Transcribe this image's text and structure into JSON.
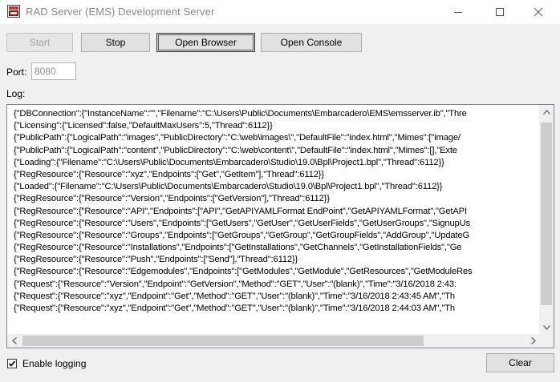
{
  "window": {
    "title": "RAD Server (EMS) Development Server",
    "minimize_glyph": "—",
    "maximize_glyph": "☐",
    "close_glyph": "✕"
  },
  "toolbar": {
    "start_label": "Start",
    "stop_label": "Stop",
    "open_browser_label": "Open Browser",
    "open_console_label": "Open Console"
  },
  "port": {
    "label": "Port:",
    "value": "8080"
  },
  "log": {
    "label": "Log:",
    "lines": [
      "{\"DBConnection\":{\"InstanceName\":\"\",\"Filename\":\"C:\\Users\\Public\\Documents\\Embarcadero\\EMS\\emsserver.ib\",\"Thre",
      "{\"Licensing\":{\"Licensed\":false,\"DefaultMaxUsers\":5,\"Thread\":6112}}",
      "{\"PublicPath\":{\"LogicalPath\":\"images\",\"PublicDirectory\":\"C:\\web\\images\\\",\"DefaultFile\":\"index.html\",\"Mimes\":[\"image/",
      "{\"PublicPath\":{\"LogicalPath\":\"content\",\"PublicDirectory\":\"C:\\web\\content\\\",\"DefaultFile\":\"index.html\",\"Mimes\":[],\"Exte",
      "{\"Loading\":{\"Filename\":\"C:\\Users\\Public\\Documents\\Embarcadero\\Studio\\19.0\\Bpl\\Project1.bpl\",\"Thread\":6112}}",
      "{\"RegResource\":{\"Resource\":\"xyz\",\"Endpoints\":[\"Get\",\"GetItem\"],\"Thread\":6112}}",
      "{\"Loaded\":{\"Filename\":\"C:\\Users\\Public\\Documents\\Embarcadero\\Studio\\19.0\\Bpl\\Project1.bpl\",\"Thread\":6112}}",
      "{\"RegResource\":{\"Resource\":\"Version\",\"Endpoints\":[\"GetVersion\"],\"Thread\":6112}}",
      "{\"RegResource\":{\"Resource\":\"API\",\"Endpoints\":[\"API\",\"GetAPIYAMLFormat EndPoint\",\"GetAPIYAMLFormat\",\"GetAPI",
      "{\"RegResource\":{\"Resource\":\"Users\",\"Endpoints\":[\"GetUsers\",\"GetUser\",\"GetUserFields\",\"GetUserGroups\",\"SignupUs",
      "{\"RegResource\":{\"Resource\":\"Groups\",\"Endpoints\":[\"GetGroups\",\"GetGroup\",\"GetGroupFields\",\"AddGroup\",\"UpdateG",
      "{\"RegResource\":{\"Resource\":\"Installations\",\"Endpoints\":[\"GetInstallations\",\"GetChannels\",\"GetInstallationFields\",\"Ge",
      "{\"RegResource\":{\"Resource\":\"Push\",\"Endpoints\":[\"Send\"],\"Thread\":6112}}",
      "{\"RegResource\":{\"Resource\":\"Edgemodules\",\"Endpoints\":[\"GetModules\",\"GetModule\",\"GetResources\",\"GetModuleRes",
      "{\"Request\":{\"Resource\":\"Version\",\"Endpoint\":\"GetVersion\",\"Method\":\"GET\",\"User\":\"(blank)\",\"Time\":\"3/16/2018 2:43:",
      "{\"Request\":{\"Resource\":\"xyz\",\"Endpoint\":\"Get\",\"Method\":\"GET\",\"User\":\"(blank)\",\"Time\":\"3/16/2018 2:43:45 AM\",\"Th",
      "{\"Request\":{\"Resource\":\"xyz\",\"Endpoint\":\"Get\",\"Method\":\"GET\",\"User\":\"(blank)\",\"Time\":\"3/16/2018 2:44:03 AM\",\"Th"
    ]
  },
  "logging": {
    "label": "Enable logging",
    "checked": true,
    "check_glyph": "✓"
  },
  "clear_label": "Clear",
  "icons": {
    "scroll_up": "up-arrow-icon",
    "scroll_down": "down-arrow-icon",
    "scroll_left": "left-arrow-icon",
    "scroll_right": "right-arrow-icon"
  }
}
